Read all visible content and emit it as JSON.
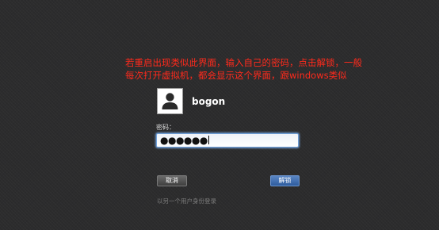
{
  "annotation": {
    "line1": "若重启出现类似此界面，输入自己的密码，点击解锁，一般",
    "line2": "每次打开虚拟机，都会显示这个界面，跟windows类似"
  },
  "user": {
    "name": "bogon",
    "avatar_icon": "user-silhouette-icon"
  },
  "password": {
    "label": "密码：",
    "value": "●●●●●●"
  },
  "buttons": {
    "cancel_label": "取消",
    "unlock_label": "解锁"
  },
  "other_user_link": "以另一个用户身份登录",
  "colors": {
    "annotation": "#ff2a1c",
    "unlock_button": "#3a6db0",
    "background": "#2c2c2d"
  }
}
